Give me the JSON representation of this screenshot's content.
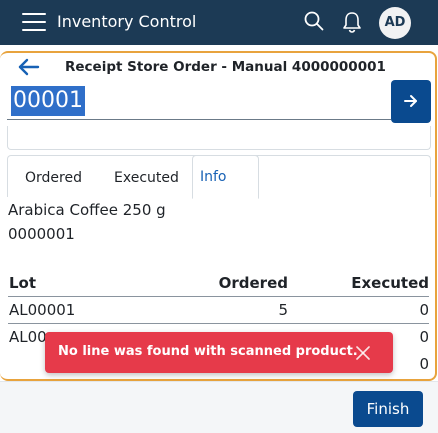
{
  "app": {
    "title": "Inventory Control",
    "avatar_initials": "AD"
  },
  "header": {
    "title": "Receipt Store Order - Manual 4000000001"
  },
  "scan": {
    "value": "00001"
  },
  "tabs": [
    {
      "label": "Ordered",
      "active": false
    },
    {
      "label": "Executed",
      "active": false
    },
    {
      "label": "Info",
      "active": true
    }
  ],
  "product": {
    "name": "Arabica Coffee 250 g",
    "code": "0000001"
  },
  "table": {
    "columns": [
      "Lot",
      "Ordered",
      "Executed"
    ],
    "rows": [
      {
        "lot": "AL00001",
        "ordered": "5",
        "executed": "0"
      },
      {
        "lot": "AL00",
        "ordered": "",
        "executed": "0"
      },
      {
        "lot": "",
        "ordered": "",
        "executed": "0"
      }
    ]
  },
  "toast": {
    "message": "No line was found with scanned product."
  },
  "footer": {
    "finish_label": "Finish"
  },
  "colors": {
    "appbar": "#1c3a55",
    "primary": "#0a4a8f",
    "accent_border": "#e8a33d",
    "toast": "#e63a4a",
    "tab_active": "#1761b5"
  }
}
